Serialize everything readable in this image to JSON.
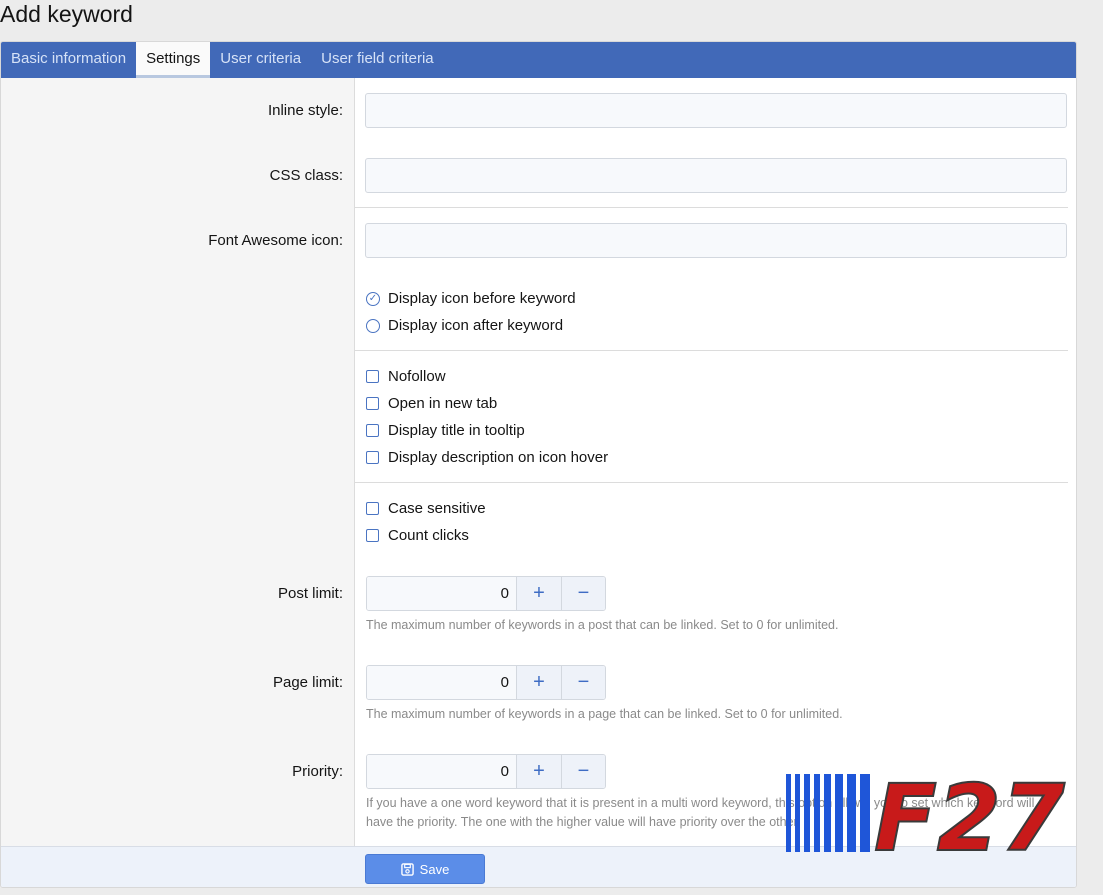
{
  "page": {
    "title": "Add keyword"
  },
  "tabs": [
    {
      "label": "Basic information"
    },
    {
      "label": "Settings"
    },
    {
      "label": "User criteria"
    },
    {
      "label": "User field criteria"
    }
  ],
  "fields": {
    "inline_style": {
      "label": "Inline style:",
      "value": ""
    },
    "css_class": {
      "label": "CSS class:",
      "value": ""
    },
    "font_awesome": {
      "label": "Font Awesome icon:",
      "value": ""
    }
  },
  "icon_position": {
    "selected": "before",
    "options": [
      {
        "label": "Display icon before keyword"
      },
      {
        "label": "Display icon after keyword"
      }
    ]
  },
  "link_options": [
    {
      "label": "Nofollow",
      "checked": false
    },
    {
      "label": "Open in new tab",
      "checked": false
    },
    {
      "label": "Display title in tooltip",
      "checked": false
    },
    {
      "label": "Display description on icon hover",
      "checked": false
    }
  ],
  "match_options": [
    {
      "label": "Case sensitive",
      "checked": false
    },
    {
      "label": "Count clicks",
      "checked": false
    }
  ],
  "steppers": {
    "post_limit": {
      "label": "Post limit:",
      "value": "0",
      "hint": "The maximum number of keywords in a post that can be linked. Set to 0 for unlimited."
    },
    "page_limit": {
      "label": "Page limit:",
      "value": "0",
      "hint": "The maximum number of keywords in a page that can be linked. Set to 0 for unlimited."
    },
    "priority": {
      "label": "Priority:",
      "value": "0",
      "hint_line1": "If you have a one word keyword that it is present in a multi word keyword, this option allows you to set which keyword will",
      "hint_line2": "have the priority. The one with the higher value will have priority over the other."
    }
  },
  "footer": {
    "save_label": "Save"
  },
  "watermark": {
    "text": "F27"
  },
  "icons": {
    "plus": "+",
    "minus": "−",
    "check": "✓"
  },
  "colors": {
    "tabbar": "#4169b8",
    "accent": "#4a74c2",
    "save": "#5b8de8"
  }
}
